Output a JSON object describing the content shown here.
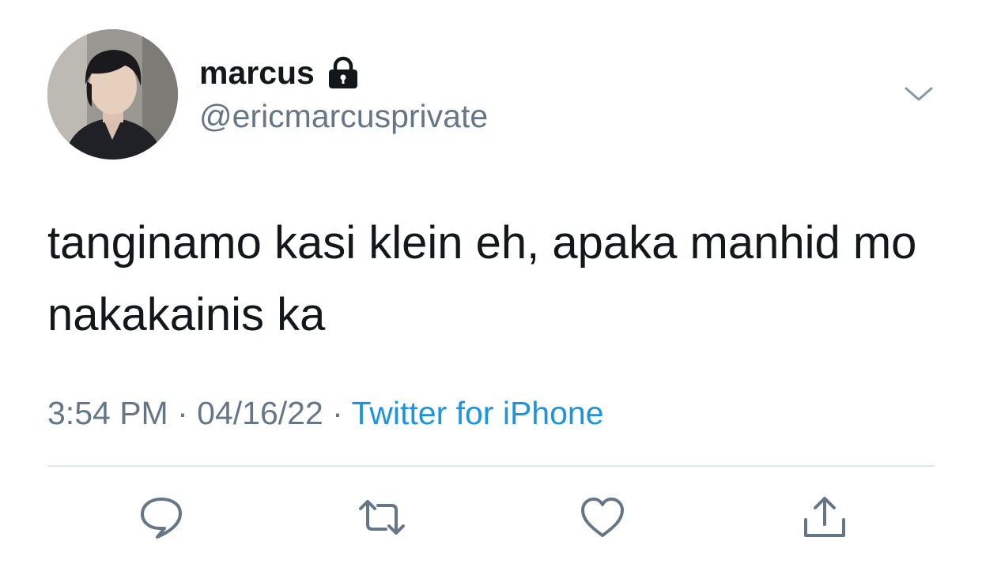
{
  "author": {
    "display_name": "marcus",
    "handle": "@ericmarcusprivate",
    "protected_icon": "lock-icon"
  },
  "tweet": {
    "text": "tanginamo kasi klein eh, apaka manhid mo nakakainis ka",
    "time": "3:54 PM",
    "date": "04/16/22",
    "separator": "·",
    "source": "Twitter for iPhone"
  },
  "actions": [
    {
      "name": "reply",
      "icon": "reply-icon"
    },
    {
      "name": "retweet",
      "icon": "retweet-icon"
    },
    {
      "name": "like",
      "icon": "heart-icon"
    },
    {
      "name": "share",
      "icon": "share-icon"
    }
  ],
  "colors": {
    "text": "#14171a",
    "secondary": "#657786",
    "link": "#1b95e0",
    "divider": "#e1e8ed"
  }
}
